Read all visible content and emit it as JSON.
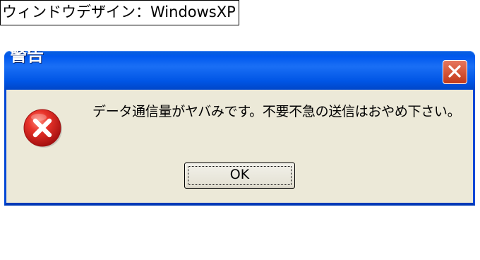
{
  "caption": {
    "text": "ウィンドウデザイン：WindowsXP"
  },
  "dialog": {
    "title": "警告",
    "message": "データ通信量がヤバみです。不要不急の送信はおやめ下さい。",
    "icon": "error-icon",
    "buttons": {
      "ok": "OK"
    },
    "close_icon": "close-icon"
  },
  "colors": {
    "titlebar": "#0058ee",
    "client_background": "#ece9d8",
    "close_button": "#d75a3c",
    "error_icon": "#d81e1e"
  }
}
